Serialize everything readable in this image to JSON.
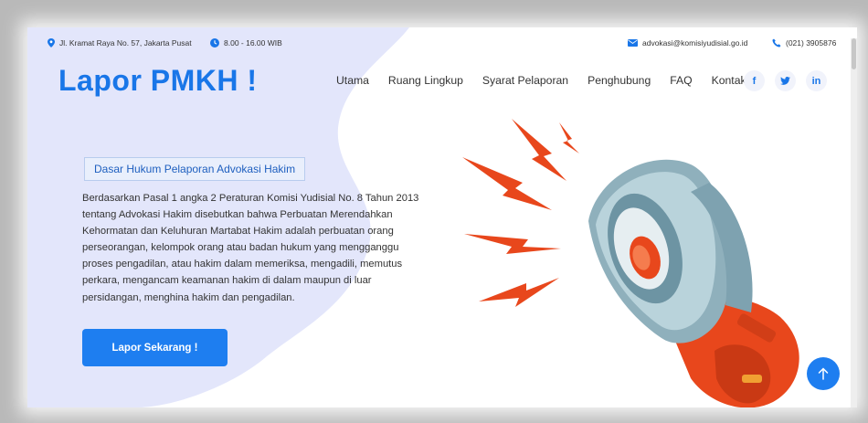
{
  "topbar": {
    "address": "Jl. Kramat Raya No. 57, Jakarta Pusat",
    "hours": "8.00 - 16.00 WIB",
    "email": "advokasi@komisiyudisial.go.id",
    "phone": "(021) 3905876"
  },
  "header": {
    "logo": "Lapor PMKH !",
    "nav": [
      "Utama",
      "Ruang Lingkup",
      "Syarat Pelaporan",
      "Penghubung",
      "FAQ",
      "Kontak"
    ],
    "social": [
      {
        "icon": "facebook-icon",
        "glyph": "f"
      },
      {
        "icon": "twitter-icon",
        "glyph": "t"
      },
      {
        "icon": "linkedin-icon",
        "glyph": "in"
      }
    ]
  },
  "hero": {
    "badge": "Dasar Hukum Pelaporan Advokasi Hakim",
    "paragraph_lines": [
      "Berdasarkan Pasal 1 angka 2 Peraturan Komisi Yudisial No. 8 Tahun 2013",
      "tentang Advokasi Hakim disebutkan bahwa Perbuatan Merendahkan",
      "Kehormatan dan Keluhuran Martabat Hakim adalah perbuatan orang",
      "perseorangan, kelompok orang atau badan hukum yang mengganggu",
      "proses pengadilan, atau hakim dalam memeriksa, mengadili, memutus",
      "perkara, mengancam keamanan hakim di dalam maupun di luar",
      "persidangan, menghina hakim dan pengadilan."
    ],
    "cta": "Lapor Sekarang !"
  },
  "colors": {
    "accent": "#1976e8",
    "blob": "#e3e6fb",
    "megaphone_red": "#e8471c",
    "megaphone_grey": "#8fb0bc"
  },
  "icons": {
    "back_to_top": "arrow-up-icon"
  }
}
